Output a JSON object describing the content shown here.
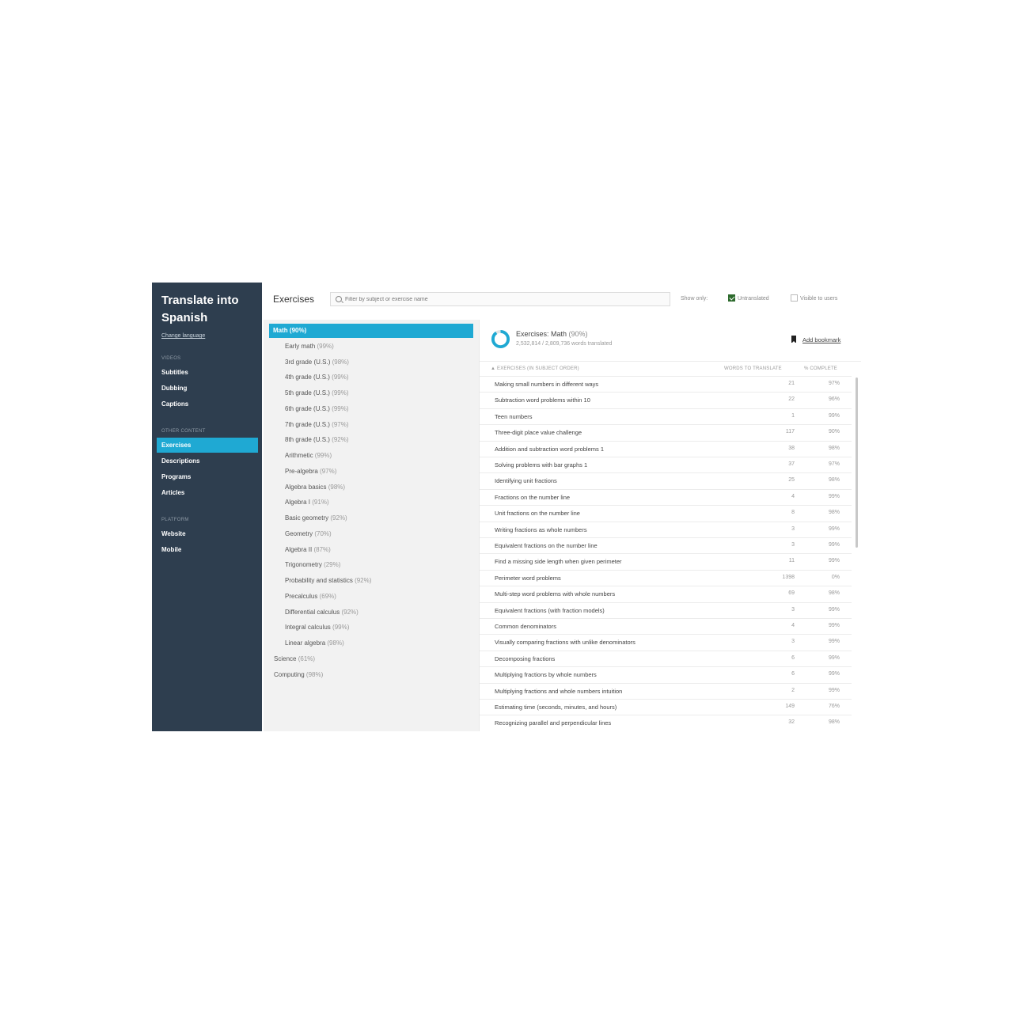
{
  "sidebar": {
    "title": "Translate into Spanish",
    "change_language": "Change language",
    "sections": [
      {
        "label": "VIDEOS",
        "items": [
          "Subtitles",
          "Dubbing",
          "Captions"
        ]
      },
      {
        "label": "OTHER CONTENT",
        "items": [
          "Exercises",
          "Descriptions",
          "Programs",
          "Articles"
        ]
      },
      {
        "label": "PLATFORM",
        "items": [
          "Website",
          "Mobile"
        ]
      }
    ],
    "active_item": "Exercises"
  },
  "header": {
    "title": "Exercises",
    "search_placeholder": "Filter by subject or exercise name",
    "show_only": "Show only:",
    "filters": [
      {
        "label": "Untranslated",
        "checked": true
      },
      {
        "label": "Visible to users",
        "checked": false
      }
    ]
  },
  "subjects": [
    {
      "name": "Math",
      "pct": "(90%)",
      "level": 0,
      "selected": true
    },
    {
      "name": "Early math",
      "pct": "(99%)",
      "level": 1
    },
    {
      "name": "3rd grade (U.S.)",
      "pct": "(98%)",
      "level": 1
    },
    {
      "name": "4th grade (U.S.)",
      "pct": "(99%)",
      "level": 1
    },
    {
      "name": "5th grade (U.S.)",
      "pct": "(99%)",
      "level": 1
    },
    {
      "name": "6th grade (U.S.)",
      "pct": "(99%)",
      "level": 1
    },
    {
      "name": "7th grade (U.S.)",
      "pct": "(97%)",
      "level": 1
    },
    {
      "name": "8th grade (U.S.)",
      "pct": "(92%)",
      "level": 1
    },
    {
      "name": "Arithmetic",
      "pct": "(99%)",
      "level": 1
    },
    {
      "name": "Pre-algebra",
      "pct": "(97%)",
      "level": 1
    },
    {
      "name": "Algebra basics",
      "pct": "(98%)",
      "level": 1
    },
    {
      "name": "Algebra I",
      "pct": "(91%)",
      "level": 1
    },
    {
      "name": "Basic geometry",
      "pct": "(92%)",
      "level": 1
    },
    {
      "name": "Geometry",
      "pct": "(70%)",
      "level": 1
    },
    {
      "name": "Algebra II",
      "pct": "(87%)",
      "level": 1
    },
    {
      "name": "Trigonometry",
      "pct": "(29%)",
      "level": 1
    },
    {
      "name": "Probability and statistics",
      "pct": "(92%)",
      "level": 1
    },
    {
      "name": "Precalculus",
      "pct": "(69%)",
      "level": 1
    },
    {
      "name": "Differential calculus",
      "pct": "(92%)",
      "level": 1
    },
    {
      "name": "Integral calculus",
      "pct": "(99%)",
      "level": 1
    },
    {
      "name": "Linear algebra",
      "pct": "(98%)",
      "level": 1
    },
    {
      "name": "Science",
      "pct": "(61%)",
      "level": 0
    },
    {
      "name": "Computing",
      "pct": "(98%)",
      "level": 0
    }
  ],
  "panel": {
    "title": "Exercises: Math",
    "title_pct": "(90%)",
    "progress": 0.9,
    "subtitle": "2,532,814 / 2,809,736 words translated",
    "bookmark": "Add bookmark",
    "columns": {
      "name": "▲ EXERCISES (IN SUBJECT ORDER)",
      "words": "WORDS TO TRANSLATE",
      "pct": "% COMPLETE"
    },
    "accent": "#1fa9d3"
  },
  "exercises": [
    {
      "name": "Making small numbers in different ways",
      "words": "21",
      "pct": "97%"
    },
    {
      "name": "Subtraction word problems within 10",
      "words": "22",
      "pct": "96%"
    },
    {
      "name": "Teen numbers",
      "words": "1",
      "pct": "99%"
    },
    {
      "name": "Three-digit place value challenge",
      "words": "117",
      "pct": "90%"
    },
    {
      "name": "Addition and subtraction word problems 1",
      "words": "38",
      "pct": "98%"
    },
    {
      "name": "Solving problems with bar graphs 1",
      "words": "37",
      "pct": "97%"
    },
    {
      "name": "Identifying unit fractions",
      "words": "25",
      "pct": "98%"
    },
    {
      "name": "Fractions on the number line",
      "words": "4",
      "pct": "99%"
    },
    {
      "name": "Unit fractions on the number line",
      "words": "8",
      "pct": "98%"
    },
    {
      "name": "Writing fractions as whole numbers",
      "words": "3",
      "pct": "99%"
    },
    {
      "name": "Equivalent fractions on the number line",
      "words": "3",
      "pct": "99%"
    },
    {
      "name": "Find a missing side length when given perimeter",
      "words": "11",
      "pct": "99%"
    },
    {
      "name": "Perimeter word problems",
      "words": "1398",
      "pct": "0%"
    },
    {
      "name": "Multi-step word problems with whole numbers",
      "words": "69",
      "pct": "98%"
    },
    {
      "name": "Equivalent fractions (with fraction models)",
      "words": "3",
      "pct": "99%"
    },
    {
      "name": "Common denominators",
      "words": "4",
      "pct": "99%"
    },
    {
      "name": "Visually comparing fractions with unlike denominators",
      "words": "3",
      "pct": "99%"
    },
    {
      "name": "Decomposing fractions",
      "words": "6",
      "pct": "99%"
    },
    {
      "name": "Multiplying fractions by whole numbers",
      "words": "6",
      "pct": "99%"
    },
    {
      "name": "Multiplying fractions and whole numbers intuition",
      "words": "2",
      "pct": "99%"
    },
    {
      "name": "Estimating time (seconds, minutes, and hours)",
      "words": "149",
      "pct": "76%"
    },
    {
      "name": "Recognizing parallel and perpendicular lines",
      "words": "32",
      "pct": "98%"
    }
  ]
}
